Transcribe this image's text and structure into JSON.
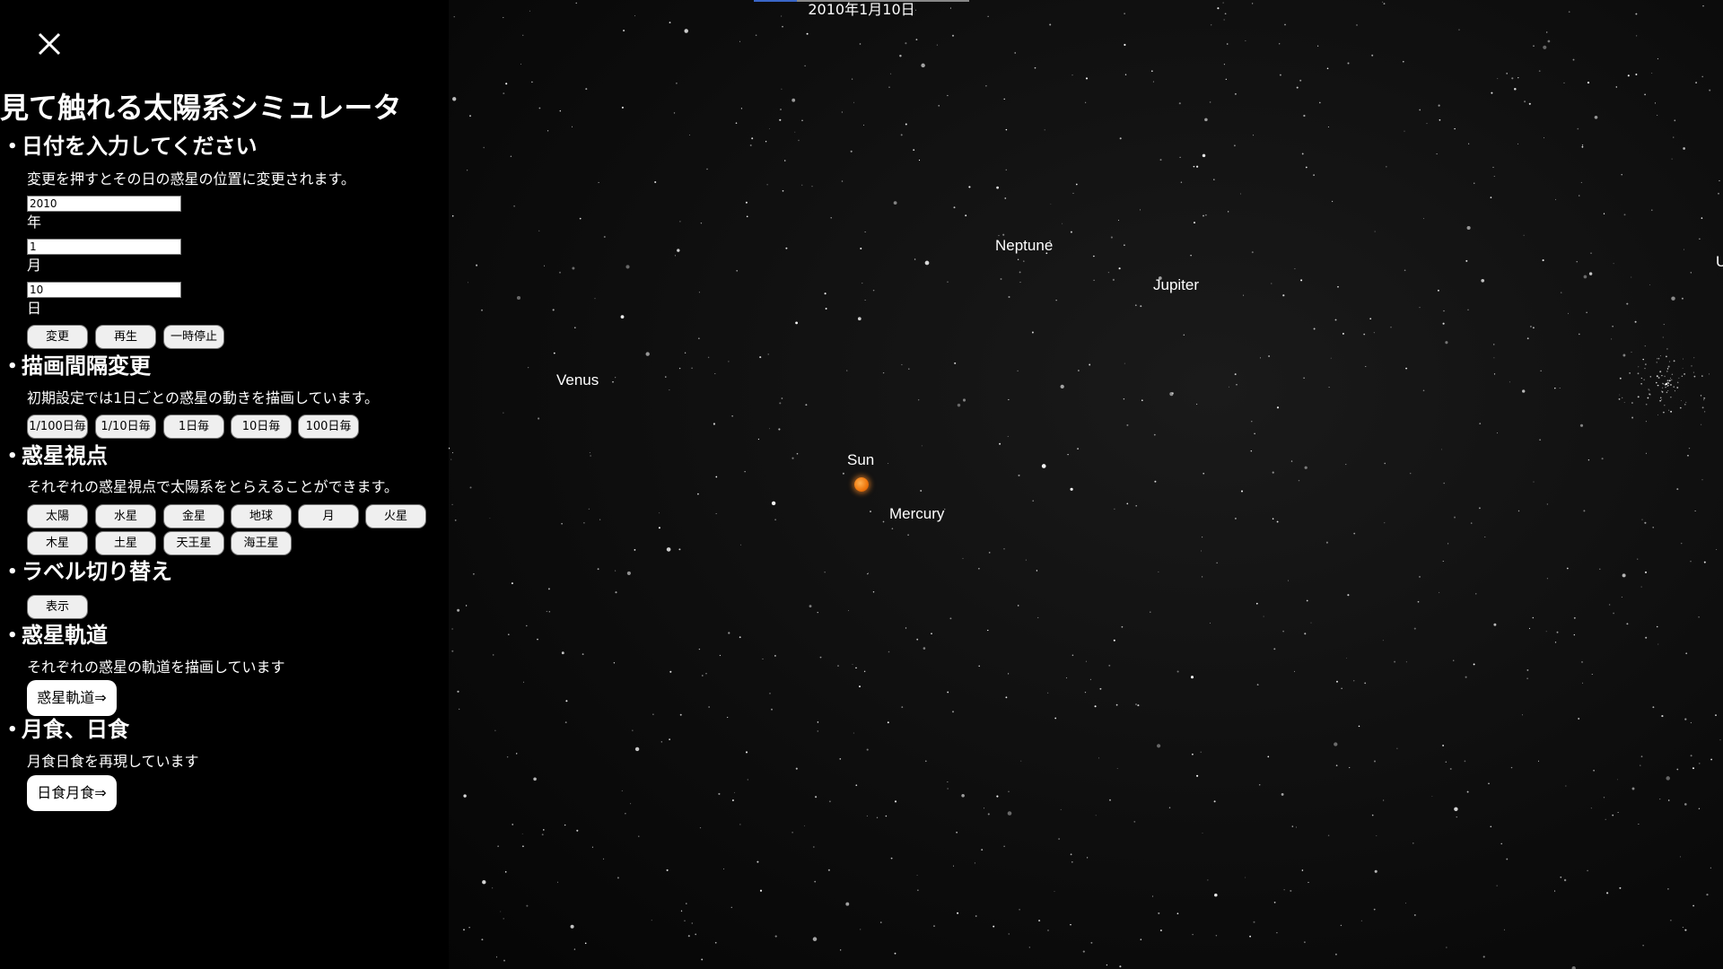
{
  "sidebar": {
    "title": "見て触れる太陽系シミュレータ",
    "date_section": {
      "heading": "日付を入力してください",
      "description": "変更を押すとその日の惑星の位置に変更されます。",
      "year_value": "2010",
      "year_unit": "年",
      "month_value": "1",
      "month_unit": "月",
      "day_value": "10",
      "day_unit": "日",
      "buttons": [
        "変更",
        "再生",
        "一時停止"
      ]
    },
    "interval_section": {
      "heading": "描画間隔変更",
      "description": "初期設定では1日ごとの惑星の動きを描画しています。",
      "buttons": [
        "1/100日毎",
        "1/10日毎",
        "1日毎",
        "10日毎",
        "100日毎"
      ]
    },
    "viewpoint_section": {
      "heading": "惑星視点",
      "description": "それぞれの惑星視点で太陽系をとらえることができます。",
      "buttons": [
        "太陽",
        "水星",
        "金星",
        "地球",
        "月",
        "火星",
        "木星",
        "土星",
        "天王星",
        "海王星"
      ]
    },
    "label_section": {
      "heading": "ラベル切り替え",
      "button": "表示"
    },
    "orbit_section": {
      "heading": "惑星軌道",
      "description": "それぞれの惑星の軌道を描画しています",
      "button": "惑星軌道⇒"
    },
    "eclipse_section": {
      "heading": "月食、日食",
      "description": "月食日食を再現しています",
      "button": "日食月食⇒"
    }
  },
  "simulation": {
    "current_date": "2010年1月10日",
    "labels": {
      "neptune": "Neptune",
      "jupiter": "Jupiter",
      "venus": "Venus",
      "sun": "Sun",
      "mercury": "Mercury",
      "uranus_partial": "U"
    },
    "sun_color": "#f07a10"
  }
}
